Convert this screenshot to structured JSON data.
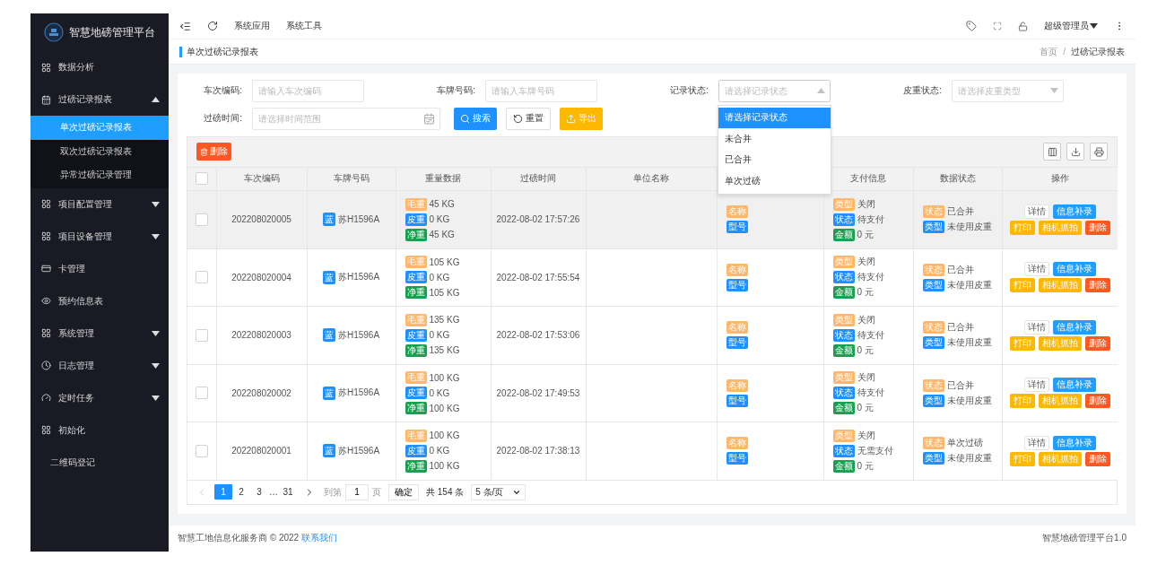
{
  "sidebar": {
    "logo_title": "智慧地磅管理平台",
    "items": [
      {
        "kind": "link",
        "label": "数据分析",
        "selected": false
      },
      {
        "kind": "submenu",
        "label": "过磅记录报表",
        "expanded": true,
        "children": [
          {
            "label": "单次过磅记录报表",
            "selected": true
          },
          {
            "label": "双次过磅记录报表",
            "selected": false
          },
          {
            "label": "异常过磅记录管理",
            "selected": false
          }
        ]
      },
      {
        "kind": "submenu",
        "label": "项目配置管理",
        "expanded": false
      },
      {
        "kind": "submenu",
        "label": "项目设备管理",
        "expanded": false
      },
      {
        "kind": "link",
        "label": "卡管理",
        "selected": false
      },
      {
        "kind": "link",
        "label": "预约信息表",
        "selected": false
      },
      {
        "kind": "submenu",
        "label": "系统管理",
        "expanded": false
      },
      {
        "kind": "submenu",
        "label": "日志管理",
        "expanded": false
      },
      {
        "kind": "submenu",
        "label": "定时任务",
        "expanded": false
      },
      {
        "kind": "link",
        "label": "初始化",
        "selected": false
      },
      {
        "kind": "link",
        "label": "二维码登记",
        "selected": false
      }
    ]
  },
  "top_bar": {
    "nav": [
      "系统应用",
      "系统工具"
    ],
    "user": "超级管理员"
  },
  "breadcrumb": {
    "title": "单次过磅记录报表",
    "crumbs": [
      "首页",
      "过磅记录报表"
    ],
    "separator": "/"
  },
  "filters": [
    {
      "kind": "text",
      "label": "车次编码:",
      "placeholder": "请输入车次编码"
    },
    {
      "kind": "text",
      "label": "车牌号码:",
      "placeholder": "请输入车牌号码"
    },
    {
      "kind": "select",
      "label": "记录状态:",
      "placeholder": "请选择记录状态",
      "open": true,
      "options": [
        {
          "label": "请选择记录状态",
          "selected": true
        },
        {
          "label": "未合并",
          "selected": false
        },
        {
          "label": "已合并",
          "selected": false
        },
        {
          "label": "单次过磅",
          "selected": false
        }
      ]
    },
    {
      "kind": "select",
      "label": "皮重状态:",
      "placeholder": "请选择皮重类型",
      "open": false
    },
    {
      "kind": "daterange",
      "label": "过磅时间:",
      "placeholder": "请选择时间范围"
    }
  ],
  "filter_buttons": [
    {
      "kind": "search",
      "label": "搜索"
    },
    {
      "kind": "reset",
      "label": "重置"
    },
    {
      "kind": "export",
      "label": "导出"
    }
  ],
  "toolbar": {
    "delete_label": "删除"
  },
  "table": {
    "header_checked": false,
    "columns": [
      {
        "label": "车次编码"
      },
      {
        "label": "车牌号码"
      },
      {
        "label": "重量数据"
      },
      {
        "label": "过磅时间"
      },
      {
        "label": "单位名称"
      },
      {
        "label": "支付信息"
      },
      {
        "label": "数据状态"
      },
      {
        "label": "操作"
      }
    ],
    "rows": [
      {
        "checked": false,
        "highlighted": true,
        "code": "202208020005",
        "plate_tag": "蓝",
        "plate": "苏H1596A",
        "weights": [
          {
            "tag": "毛重",
            "color": "#ffb86b",
            "value": "45 KG"
          },
          {
            "tag": "皮重",
            "color": "#1e90ff",
            "value": "0 KG"
          },
          {
            "tag": "净重",
            "color": "#16a04f",
            "value": "45 KG"
          }
        ],
        "time": "2022-08-02 17:57:26",
        "device": [
          {
            "tag": "名称",
            "color": "#ffb86b"
          },
          {
            "tag": "型号",
            "color": "#1e90ff"
          }
        ],
        "payment": [
          {
            "tag": "类型",
            "color": "#ffb86b",
            "value": "关闭"
          },
          {
            "tag": "状态",
            "color": "#1e90ff",
            "value": "待支付"
          },
          {
            "tag": "金额",
            "color": "#16a04f",
            "value": "0 元"
          }
        ],
        "status": [
          {
            "tag": "状态",
            "color": "#ffb86b",
            "value": "已合并"
          },
          {
            "tag": "类型",
            "color": "#1e90ff",
            "value": "未使用皮重"
          }
        ],
        "action_rows": [
          {
            "buttons": [
              {
                "kind": "plain",
                "label": "详情"
              },
              {
                "kind": "primary",
                "label": "信息补录"
              }
            ]
          },
          {
            "buttons": [
              {
                "kind": "warm",
                "label": "打印"
              },
              {
                "kind": "warm",
                "label": "相机抓拍"
              },
              {
                "kind": "danger",
                "label": "删除"
              }
            ]
          }
        ]
      },
      {
        "checked": false,
        "highlighted": false,
        "code": "202208020004",
        "plate_tag": "蓝",
        "plate": "苏H1596A",
        "weights": [
          {
            "tag": "毛重",
            "color": "#ffb86b",
            "value": "105 KG"
          },
          {
            "tag": "皮重",
            "color": "#1e90ff",
            "value": "0 KG"
          },
          {
            "tag": "净重",
            "color": "#16a04f",
            "value": "105 KG"
          }
        ],
        "time": "2022-08-02 17:55:54",
        "device": [
          {
            "tag": "名称",
            "color": "#ffb86b"
          },
          {
            "tag": "型号",
            "color": "#1e90ff"
          }
        ],
        "payment": [
          {
            "tag": "类型",
            "color": "#ffb86b",
            "value": "关闭"
          },
          {
            "tag": "状态",
            "color": "#1e90ff",
            "value": "待支付"
          },
          {
            "tag": "金额",
            "color": "#16a04f",
            "value": "0 元"
          }
        ],
        "status": [
          {
            "tag": "状态",
            "color": "#ffb86b",
            "value": "已合并"
          },
          {
            "tag": "类型",
            "color": "#1e90ff",
            "value": "未使用皮重"
          }
        ],
        "action_rows": [
          {
            "buttons": [
              {
                "kind": "plain",
                "label": "详情"
              },
              {
                "kind": "primary",
                "label": "信息补录"
              }
            ]
          },
          {
            "buttons": [
              {
                "kind": "warm",
                "label": "打印"
              },
              {
                "kind": "warm",
                "label": "相机抓拍"
              },
              {
                "kind": "danger",
                "label": "删除"
              }
            ]
          }
        ]
      },
      {
        "checked": false,
        "highlighted": false,
        "code": "202208020003",
        "plate_tag": "蓝",
        "plate": "苏H1596A",
        "weights": [
          {
            "tag": "毛重",
            "color": "#ffb86b",
            "value": "135 KG"
          },
          {
            "tag": "皮重",
            "color": "#1e90ff",
            "value": "0 KG"
          },
          {
            "tag": "净重",
            "color": "#16a04f",
            "value": "135 KG"
          }
        ],
        "time": "2022-08-02 17:53:06",
        "device": [
          {
            "tag": "名称",
            "color": "#ffb86b"
          },
          {
            "tag": "型号",
            "color": "#1e90ff"
          }
        ],
        "payment": [
          {
            "tag": "类型",
            "color": "#ffb86b",
            "value": "关闭"
          },
          {
            "tag": "状态",
            "color": "#1e90ff",
            "value": "待支付"
          },
          {
            "tag": "金额",
            "color": "#16a04f",
            "value": "0 元"
          }
        ],
        "status": [
          {
            "tag": "状态",
            "color": "#ffb86b",
            "value": "已合并"
          },
          {
            "tag": "类型",
            "color": "#1e90ff",
            "value": "未使用皮重"
          }
        ],
        "action_rows": [
          {
            "buttons": [
              {
                "kind": "plain",
                "label": "详情"
              },
              {
                "kind": "primary",
                "label": "信息补录"
              }
            ]
          },
          {
            "buttons": [
              {
                "kind": "warm",
                "label": "打印"
              },
              {
                "kind": "warm",
                "label": "相机抓拍"
              },
              {
                "kind": "danger",
                "label": "删除"
              }
            ]
          }
        ]
      },
      {
        "checked": false,
        "highlighted": false,
        "code": "202208020002",
        "plate_tag": "蓝",
        "plate": "苏H1596A",
        "weights": [
          {
            "tag": "毛重",
            "color": "#ffb86b",
            "value": "100 KG"
          },
          {
            "tag": "皮重",
            "color": "#1e90ff",
            "value": "0 KG"
          },
          {
            "tag": "净重",
            "color": "#16a04f",
            "value": "100 KG"
          }
        ],
        "time": "2022-08-02 17:49:53",
        "device": [
          {
            "tag": "名称",
            "color": "#ffb86b"
          },
          {
            "tag": "型号",
            "color": "#1e90ff"
          }
        ],
        "payment": [
          {
            "tag": "类型",
            "color": "#ffb86b",
            "value": "关闭"
          },
          {
            "tag": "状态",
            "color": "#1e90ff",
            "value": "待支付"
          },
          {
            "tag": "金额",
            "color": "#16a04f",
            "value": "0 元"
          }
        ],
        "status": [
          {
            "tag": "状态",
            "color": "#ffb86b",
            "value": "已合并"
          },
          {
            "tag": "类型",
            "color": "#1e90ff",
            "value": "未使用皮重"
          }
        ],
        "action_rows": [
          {
            "buttons": [
              {
                "kind": "plain",
                "label": "详情"
              },
              {
                "kind": "primary",
                "label": "信息补录"
              }
            ]
          },
          {
            "buttons": [
              {
                "kind": "warm",
                "label": "打印"
              },
              {
                "kind": "warm",
                "label": "相机抓拍"
              },
              {
                "kind": "danger",
                "label": "删除"
              }
            ]
          }
        ]
      },
      {
        "checked": false,
        "highlighted": false,
        "code": "202208020001",
        "plate_tag": "蓝",
        "plate": "苏H1596A",
        "weights": [
          {
            "tag": "毛重",
            "color": "#ffb86b",
            "value": "100 KG"
          },
          {
            "tag": "皮重",
            "color": "#1e90ff",
            "value": "0 KG"
          },
          {
            "tag": "净重",
            "color": "#16a04f",
            "value": "100 KG"
          }
        ],
        "time": "2022-08-02 17:38:13",
        "device": [
          {
            "tag": "名称",
            "color": "#ffb86b"
          },
          {
            "tag": "型号",
            "color": "#1e90ff"
          }
        ],
        "payment": [
          {
            "tag": "类型",
            "color": "#ffb86b",
            "value": "关闭"
          },
          {
            "tag": "状态",
            "color": "#1e90ff",
            "value": "无需支付"
          },
          {
            "tag": "金额",
            "color": "#16a04f",
            "value": "0 元"
          }
        ],
        "status": [
          {
            "tag": "状态",
            "color": "#ffb86b",
            "value": "单次过磅"
          },
          {
            "tag": "类型",
            "color": "#1e90ff",
            "value": "未使用皮重"
          }
        ],
        "action_rows": [
          {
            "buttons": [
              {
                "kind": "plain",
                "label": "详情"
              },
              {
                "kind": "primary",
                "label": "信息补录"
              }
            ]
          },
          {
            "buttons": [
              {
                "kind": "warm",
                "label": "打印"
              },
              {
                "kind": "warm",
                "label": "相机抓拍"
              },
              {
                "kind": "danger",
                "label": "删除"
              }
            ]
          }
        ]
      }
    ]
  },
  "pagination": {
    "pages": [
      {
        "label": "1",
        "selected": true
      },
      {
        "label": "2",
        "selected": false
      },
      {
        "label": "3",
        "selected": false
      }
    ],
    "ellipsis": "…",
    "last_page": "31",
    "goto_label": "到第",
    "goto_value": "1",
    "page_unit": "页",
    "confirm": "确定",
    "total": "共 154 条",
    "page_size": "5 条/页"
  },
  "footer": {
    "text": "智慧工地信息化服务商 © 2022",
    "link": "联系我们",
    "version": "智慧地磅管理平台1.0"
  }
}
